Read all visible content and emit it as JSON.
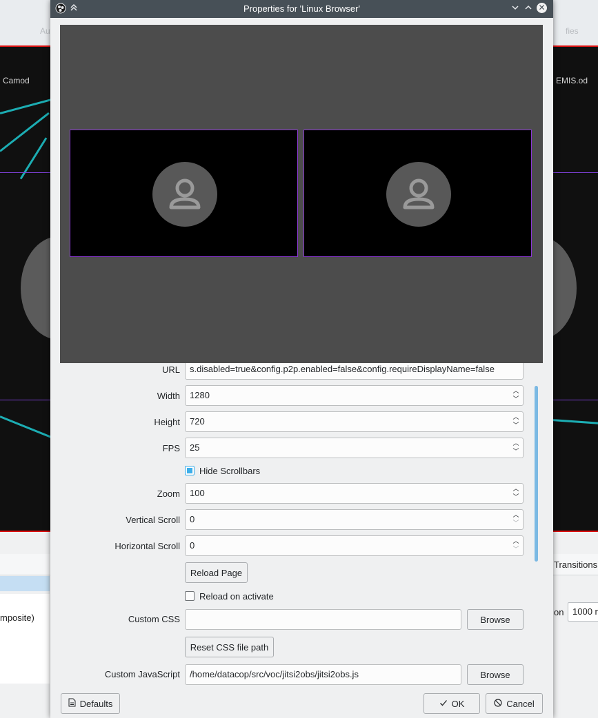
{
  "background": {
    "top_text": [
      "Au",
      "fies"
    ],
    "preview_labels": [
      "Camod",
      "EMIS.od"
    ],
    "bottom_tab_right": "Transitions",
    "list_item": "mposite)",
    "duration_label": "on",
    "duration_value": "1000 m"
  },
  "dialog": {
    "title": "Properties for 'Linux Browser'",
    "fields": {
      "url": {
        "label": "URL",
        "value": "s.disabled=true&config.p2p.enabled=false&config.requireDisplayName=false"
      },
      "width": {
        "label": "Width",
        "value": "1280"
      },
      "height": {
        "label": "Height",
        "value": "720"
      },
      "fps": {
        "label": "FPS",
        "value": "25"
      },
      "hide_scrollbars": {
        "label": "Hide Scrollbars",
        "checked": true
      },
      "zoom": {
        "label": "Zoom",
        "value": "100"
      },
      "vertical_scroll": {
        "label": "Vertical Scroll",
        "value": "0"
      },
      "horizontal_scroll": {
        "label": "Horizontal Scroll",
        "value": "0"
      },
      "reload_page": {
        "label": "Reload Page"
      },
      "reload_on_activate": {
        "label": "Reload on activate",
        "checked": false
      },
      "custom_css": {
        "label": "Custom CSS",
        "value": "",
        "browse_label": "Browse"
      },
      "reset_css": {
        "label": "Reset CSS file path"
      },
      "custom_js": {
        "label": "Custom JavaScript",
        "value": "/home/datacop/src/voc/jitsi2obs/jitsi2obs.js",
        "browse_label": "Browse"
      }
    },
    "footer": {
      "defaults_label": "Defaults",
      "ok_label": "OK",
      "cancel_label": "Cancel"
    }
  },
  "colors": {
    "titlebar": "#475057",
    "tile_border": "#8a38d3",
    "accent": "#3daee9",
    "neon": "#1fc9d0",
    "preview_border": "#dd1111"
  },
  "icons": [
    "obs-app-icon",
    "keep-above-icon",
    "minimize-icon",
    "maximize-icon",
    "close-icon",
    "person-icon",
    "document-icon",
    "check-icon",
    "cancel-icon"
  ]
}
